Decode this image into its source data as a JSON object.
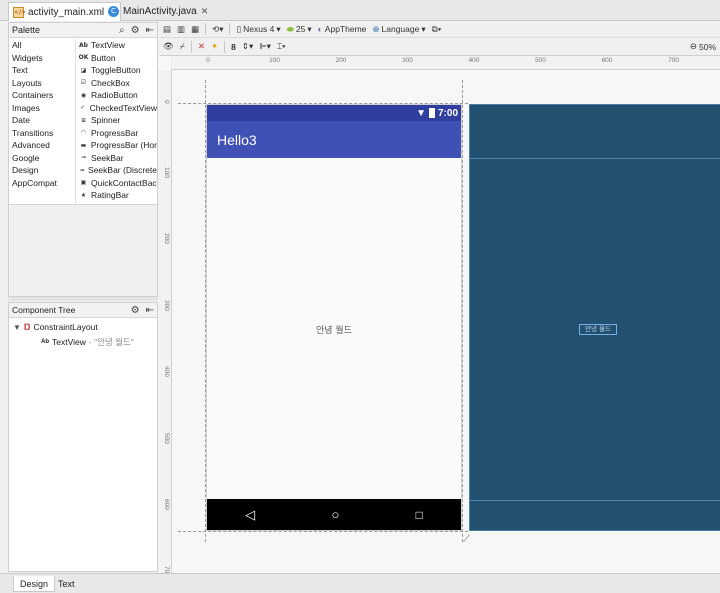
{
  "file_tabs": [
    {
      "label": "activity_main.xml",
      "icon": "xml-file-icon",
      "active": true
    },
    {
      "label": "MainActivity.java",
      "icon": "java-class-icon",
      "active": false
    }
  ],
  "palette": {
    "title": "Palette",
    "categories": [
      "All",
      "Widgets",
      "Text",
      "Layouts",
      "Containers",
      "Images",
      "Date",
      "Transitions",
      "Advanced",
      "Google",
      "Design",
      "AppCompat"
    ],
    "items": [
      {
        "label": "TextView",
        "glyph": "Ab"
      },
      {
        "label": "Button",
        "glyph": "OK"
      },
      {
        "label": "ToggleButton",
        "glyph": "◪"
      },
      {
        "label": "CheckBox",
        "glyph": "☑"
      },
      {
        "label": "RadioButton",
        "glyph": "◉"
      },
      {
        "label": "CheckedTextView",
        "glyph": "✓"
      },
      {
        "label": "Spinner",
        "glyph": "≡"
      },
      {
        "label": "ProgressBar",
        "glyph": "◠"
      },
      {
        "label": "ProgressBar (Hor",
        "glyph": "▬"
      },
      {
        "label": "SeekBar",
        "glyph": "⊸"
      },
      {
        "label": "SeekBar (Discrete",
        "glyph": "⊸"
      },
      {
        "label": "QuickContactBac",
        "glyph": "▣"
      },
      {
        "label": "RatingBar",
        "glyph": "★"
      }
    ]
  },
  "component_tree": {
    "title": "Component Tree",
    "root": "ConstraintLayout",
    "child_label": "TextView",
    "child_value": "- \"안녕 월드\"",
    "child_glyph": "Ab"
  },
  "toolbar1": {
    "device": "Nexus 4",
    "api": "25",
    "theme": "AppTheme",
    "language": "Language",
    "zoom": "50%"
  },
  "toolbar2": {
    "margin": "8"
  },
  "rulers": {
    "h_labels": [
      "0",
      "100",
      "200",
      "300",
      "400",
      "500",
      "600",
      "700"
    ],
    "v_labels": [
      "0",
      "100",
      "200",
      "300",
      "400",
      "500",
      "600",
      "700"
    ]
  },
  "preview": {
    "time": "7:00",
    "app_title": "Hello3",
    "center_text": "안녕 월드",
    "colors": {
      "status_bar": "#303f9f",
      "app_bar": "#3f51b5",
      "blueprint": "#22506f"
    }
  },
  "blueprint": {
    "text": "안녕 월드"
  },
  "bottom_tabs": [
    {
      "label": "Design",
      "active": true
    },
    {
      "label": "Text",
      "active": false
    }
  ]
}
